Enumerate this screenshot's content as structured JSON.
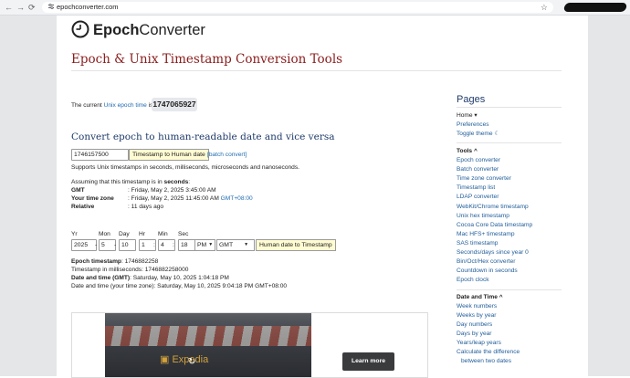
{
  "browser": {
    "url": "epochconverter.com",
    "nav_back": "←",
    "nav_forward": "→",
    "nav_reload": "⟳",
    "site_info_icon": "tune-icon",
    "star_icon": "☆"
  },
  "header": {
    "logo_text_bold": "Epoch",
    "logo_text_rest": "Converter",
    "page_title": "Epoch & Unix Timestamp Conversion Tools"
  },
  "current": {
    "prefix": "The current",
    "link": "Unix epoch time",
    "suffix": "is",
    "value": "1747065927"
  },
  "convert": {
    "heading": "Convert epoch to human-readable date and vice versa",
    "input_value": "1746157500",
    "button_label": "Timestamp to Human date",
    "batch_link": "[batch convert]",
    "supports": "Supports Unix timestamps in seconds, milliseconds, microseconds and nanoseconds.",
    "assuming_prefix": "Assuming that this timestamp is in",
    "assuming_unit": "seconds",
    "assuming_suffix": ":",
    "rows": [
      {
        "label": "GMT",
        "value": ": Friday, May 2, 2025 3:45:00 AM",
        "extra": ""
      },
      {
        "label": "Your time zone",
        "value": ": Friday, May 2, 2025 11:45:00 AM",
        "extra": "GMT+08:00"
      },
      {
        "label": "Relative",
        "value": ": 11 days ago",
        "extra": ""
      }
    ]
  },
  "human": {
    "labels": {
      "yr": "Yr",
      "mon": "Mon",
      "day": "Day",
      "hr": "Hr",
      "min": "Min",
      "sec": "Sec"
    },
    "values": {
      "yr": "2025",
      "mon": "5",
      "day": "10",
      "hr": "1",
      "min": "4",
      "sec": "18",
      "ampm": "PM",
      "tz": "GMT"
    },
    "separator_dash": "-",
    "separator_colon": ":",
    "button_label": "Human date to Timestamp",
    "result": [
      {
        "label": "Epoch timestamp",
        "value": ": 1746882258"
      },
      {
        "label": "",
        "value": "Timestamp in milliseconds: 1746882258000"
      },
      {
        "label": "Date and time (GMT)",
        "value": ": Saturday, May 10, 2025 1:04:18 PM"
      },
      {
        "label": "",
        "value": "Date and time (your time zone): Saturday, May 10, 2025 9:04:18 PM GMT+08:00"
      }
    ]
  },
  "ad": {
    "brand": "Expedia",
    "button": "Learn more"
  },
  "sidebar": {
    "pages_heading": "Pages",
    "pages": [
      {
        "label": "Home",
        "suffix": " ▾"
      },
      {
        "label": "Preferences",
        "suffix": ""
      },
      {
        "label": "Toggle theme",
        "suffix": " ☾"
      }
    ],
    "tools_heading": "Tools",
    "tools_caret": "^",
    "tools": [
      "Epoch converter",
      "Batch converter",
      "Time zone converter",
      "Timestamp list",
      "LDAP converter",
      "WebKit/Chrome timestamp",
      "Unix hex timestamp",
      "Cocoa Core Data timestamp",
      "Mac HFS+ timestamp",
      "SAS timestamp",
      "Seconds/days since year 0",
      "Bin/Oct/Hex converter",
      "Countdown in seconds",
      "Epoch clock"
    ],
    "datetime_heading": "Date and Time",
    "datetime_caret": "^",
    "datetime": [
      "Week numbers",
      "Weeks by year",
      "Day numbers",
      "Days by year",
      "Years/leap years",
      "Calculate the difference",
      "between two dates"
    ]
  }
}
